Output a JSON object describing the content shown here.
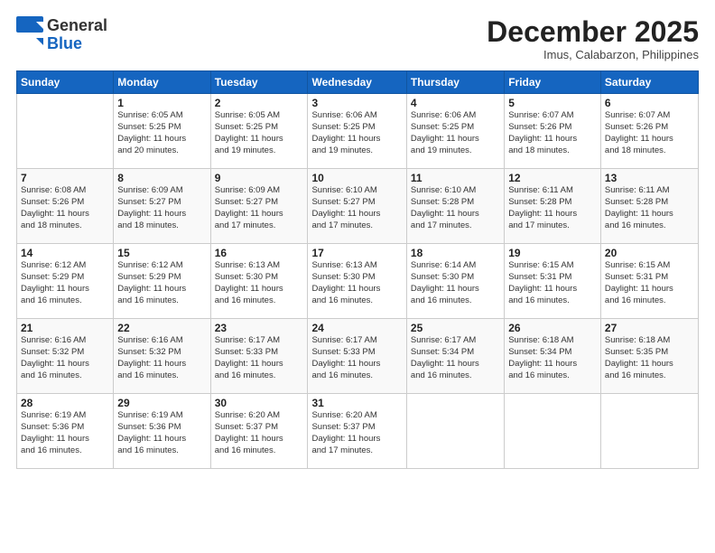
{
  "logo": {
    "general": "General",
    "blue": "Blue"
  },
  "header": {
    "month": "December 2025",
    "location": "Imus, Calabarzon, Philippines"
  },
  "weekdays": [
    "Sunday",
    "Monday",
    "Tuesday",
    "Wednesday",
    "Thursday",
    "Friday",
    "Saturday"
  ],
  "weeks": [
    [
      {
        "day": "",
        "info": ""
      },
      {
        "day": "1",
        "info": "Sunrise: 6:05 AM\nSunset: 5:25 PM\nDaylight: 11 hours\nand 20 minutes."
      },
      {
        "day": "2",
        "info": "Sunrise: 6:05 AM\nSunset: 5:25 PM\nDaylight: 11 hours\nand 19 minutes."
      },
      {
        "day": "3",
        "info": "Sunrise: 6:06 AM\nSunset: 5:25 PM\nDaylight: 11 hours\nand 19 minutes."
      },
      {
        "day": "4",
        "info": "Sunrise: 6:06 AM\nSunset: 5:25 PM\nDaylight: 11 hours\nand 19 minutes."
      },
      {
        "day": "5",
        "info": "Sunrise: 6:07 AM\nSunset: 5:26 PM\nDaylight: 11 hours\nand 18 minutes."
      },
      {
        "day": "6",
        "info": "Sunrise: 6:07 AM\nSunset: 5:26 PM\nDaylight: 11 hours\nand 18 minutes."
      }
    ],
    [
      {
        "day": "7",
        "info": "Sunrise: 6:08 AM\nSunset: 5:26 PM\nDaylight: 11 hours\nand 18 minutes."
      },
      {
        "day": "8",
        "info": "Sunrise: 6:09 AM\nSunset: 5:27 PM\nDaylight: 11 hours\nand 18 minutes."
      },
      {
        "day": "9",
        "info": "Sunrise: 6:09 AM\nSunset: 5:27 PM\nDaylight: 11 hours\nand 17 minutes."
      },
      {
        "day": "10",
        "info": "Sunrise: 6:10 AM\nSunset: 5:27 PM\nDaylight: 11 hours\nand 17 minutes."
      },
      {
        "day": "11",
        "info": "Sunrise: 6:10 AM\nSunset: 5:28 PM\nDaylight: 11 hours\nand 17 minutes."
      },
      {
        "day": "12",
        "info": "Sunrise: 6:11 AM\nSunset: 5:28 PM\nDaylight: 11 hours\nand 17 minutes."
      },
      {
        "day": "13",
        "info": "Sunrise: 6:11 AM\nSunset: 5:28 PM\nDaylight: 11 hours\nand 16 minutes."
      }
    ],
    [
      {
        "day": "14",
        "info": "Sunrise: 6:12 AM\nSunset: 5:29 PM\nDaylight: 11 hours\nand 16 minutes."
      },
      {
        "day": "15",
        "info": "Sunrise: 6:12 AM\nSunset: 5:29 PM\nDaylight: 11 hours\nand 16 minutes."
      },
      {
        "day": "16",
        "info": "Sunrise: 6:13 AM\nSunset: 5:30 PM\nDaylight: 11 hours\nand 16 minutes."
      },
      {
        "day": "17",
        "info": "Sunrise: 6:13 AM\nSunset: 5:30 PM\nDaylight: 11 hours\nand 16 minutes."
      },
      {
        "day": "18",
        "info": "Sunrise: 6:14 AM\nSunset: 5:30 PM\nDaylight: 11 hours\nand 16 minutes."
      },
      {
        "day": "19",
        "info": "Sunrise: 6:15 AM\nSunset: 5:31 PM\nDaylight: 11 hours\nand 16 minutes."
      },
      {
        "day": "20",
        "info": "Sunrise: 6:15 AM\nSunset: 5:31 PM\nDaylight: 11 hours\nand 16 minutes."
      }
    ],
    [
      {
        "day": "21",
        "info": "Sunrise: 6:16 AM\nSunset: 5:32 PM\nDaylight: 11 hours\nand 16 minutes."
      },
      {
        "day": "22",
        "info": "Sunrise: 6:16 AM\nSunset: 5:32 PM\nDaylight: 11 hours\nand 16 minutes."
      },
      {
        "day": "23",
        "info": "Sunrise: 6:17 AM\nSunset: 5:33 PM\nDaylight: 11 hours\nand 16 minutes."
      },
      {
        "day": "24",
        "info": "Sunrise: 6:17 AM\nSunset: 5:33 PM\nDaylight: 11 hours\nand 16 minutes."
      },
      {
        "day": "25",
        "info": "Sunrise: 6:17 AM\nSunset: 5:34 PM\nDaylight: 11 hours\nand 16 minutes."
      },
      {
        "day": "26",
        "info": "Sunrise: 6:18 AM\nSunset: 5:34 PM\nDaylight: 11 hours\nand 16 minutes."
      },
      {
        "day": "27",
        "info": "Sunrise: 6:18 AM\nSunset: 5:35 PM\nDaylight: 11 hours\nand 16 minutes."
      }
    ],
    [
      {
        "day": "28",
        "info": "Sunrise: 6:19 AM\nSunset: 5:36 PM\nDaylight: 11 hours\nand 16 minutes."
      },
      {
        "day": "29",
        "info": "Sunrise: 6:19 AM\nSunset: 5:36 PM\nDaylight: 11 hours\nand 16 minutes."
      },
      {
        "day": "30",
        "info": "Sunrise: 6:20 AM\nSunset: 5:37 PM\nDaylight: 11 hours\nand 16 minutes."
      },
      {
        "day": "31",
        "info": "Sunrise: 6:20 AM\nSunset: 5:37 PM\nDaylight: 11 hours\nand 17 minutes."
      },
      {
        "day": "",
        "info": ""
      },
      {
        "day": "",
        "info": ""
      },
      {
        "day": "",
        "info": ""
      }
    ]
  ]
}
